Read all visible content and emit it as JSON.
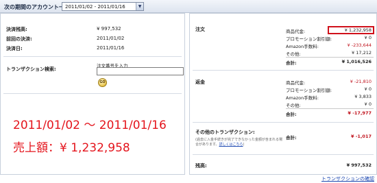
{
  "topbar": {
    "label": "次の期間のアカウント一覧",
    "period": "2011/01/02 - 2011/01/16"
  },
  "left": {
    "closing_balance_label": "決済残高:",
    "closing_balance_value": "¥ 997,532",
    "prev_settlement_label": "前回の決済:",
    "prev_settlement_value": "2011/01/02",
    "settlement_date_label": "決済日:",
    "settlement_date_value": "2011/01/16",
    "txn_search_label": "トランザクション検索:",
    "txn_input_caption": "注文番号を入力",
    "go_label": "GO",
    "annotation_range": "2011/01/02 ～ 2011/01/16",
    "annotation_sales": "売上額：¥ 1,232,958"
  },
  "right": {
    "orders": {
      "title": "注文",
      "rows": [
        {
          "label": "商品代金:",
          "value": "¥ 1,232,958",
          "neg": false
        },
        {
          "label": "プロモーション割引額:",
          "value": "¥ 0",
          "neg": false
        },
        {
          "label": "Amazon手数料:",
          "value": "¥ -233,644",
          "neg": true
        },
        {
          "label": "その他:",
          "value": "¥ 17,212",
          "neg": false
        }
      ],
      "total_label": "合計:",
      "total_value": "¥ 1,016,526"
    },
    "refunds": {
      "title": "返金",
      "rows": [
        {
          "label": "商品代金:",
          "value": "¥ -21,810",
          "neg": true
        },
        {
          "label": "プロモーション割引額:",
          "value": "¥ 0",
          "neg": false
        },
        {
          "label": "Amazon手数料:",
          "value": "¥ 3,833",
          "neg": false
        },
        {
          "label": "その他:",
          "value": "¥ 0",
          "neg": false
        }
      ],
      "total_label": "合計:",
      "total_value": "¥ -17,977"
    },
    "other": {
      "title": "その他のトランザクション:",
      "total_label": "合計:",
      "total_value": "¥ -1,017",
      "note": "(過去に入金手続きが完了できなかった金額が含まれる場合があります。",
      "note_link": "詳しくはこちら",
      "note_end": ")"
    },
    "balance_label": "残高:",
    "balance_value": "¥ 997,532"
  },
  "footer": {
    "link": "トランザクションの確認"
  }
}
